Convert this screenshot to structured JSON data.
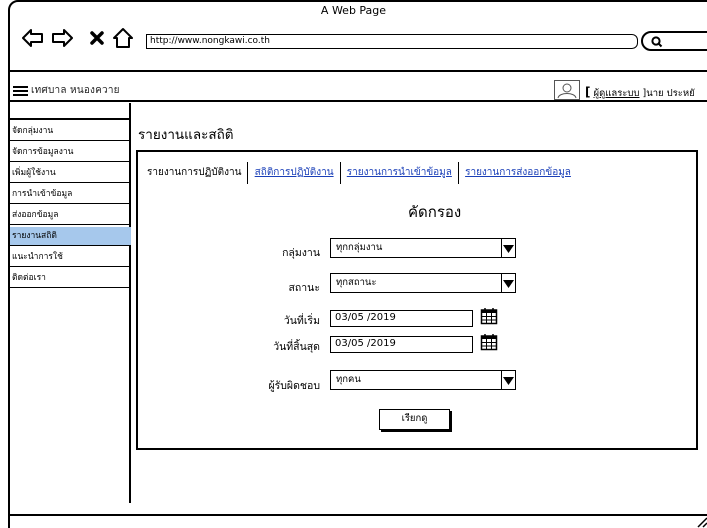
{
  "window": {
    "title": "A Web Page",
    "url": "http://www.nongkawi.co.th"
  },
  "header": {
    "brand": "เทศบาล หนองควาย",
    "user_prefix": "[",
    "user_role": "ผู้ดูแลระบบ",
    "user_suffix": "]นาย ประหยั"
  },
  "sidebar": {
    "items": [
      {
        "label": "จัดกลุ่มงาน",
        "active": false
      },
      {
        "label": "จัดการข้อมูลงาน",
        "active": false
      },
      {
        "label": "เพิ่มผู้ใช้งาน",
        "active": false
      },
      {
        "label": "การนำเข้าข้อมูล",
        "active": false
      },
      {
        "label": "ส่งออกข้อมูล",
        "active": false
      },
      {
        "label": "รายงานสถิติ",
        "active": true
      },
      {
        "label": "แนะนำการใช้",
        "active": false
      },
      {
        "label": "ติดต่อเรา",
        "active": false
      }
    ]
  },
  "main": {
    "title": "รายงานและสถิติ",
    "tabs": [
      {
        "label": "รายงานการปฏิบัติงาน",
        "link": false
      },
      {
        "label": "สถิติการปฏิบัติงาน",
        "link": true
      },
      {
        "label": "รายงานการนำเข้าข้อมูล",
        "link": true
      },
      {
        "label": "รายงานการส่งออกข้อมูล",
        "link": true
      }
    ],
    "filter": {
      "title": "คัดกรอง",
      "group_label": "กลุ่มงาน",
      "group_value": "ทุกกลุ่มงาน",
      "status_label": "สถานะ",
      "status_value": "ทุกสถานะ",
      "start_label": "วันที่เริ่ม",
      "start_value": "03/05 /2019",
      "end_label": "วันที่สิ้นสุด",
      "end_value": "03/05 /2019",
      "owner_label": "ผู้รับผิดชอบ",
      "owner_value": "ทุกคน",
      "search_button": "เรียกดู"
    }
  }
}
